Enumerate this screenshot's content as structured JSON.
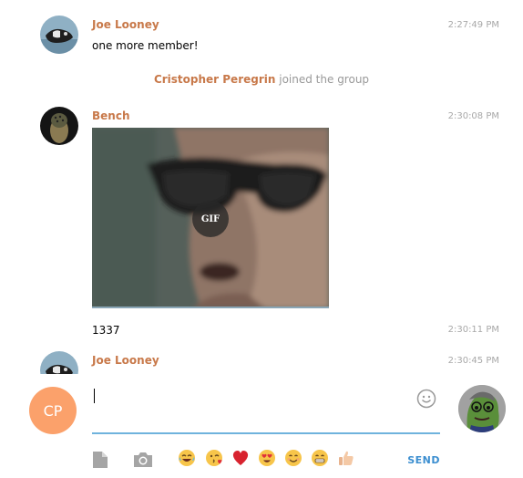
{
  "messages": [
    {
      "sender": "Joe Looney",
      "time": "2:27:49 PM",
      "text": "one more member!"
    },
    {
      "service_name": "Cristopher Peregrin",
      "service_text": "joined the group"
    },
    {
      "sender": "Bench",
      "time": "2:30:08 PM",
      "gif_label": "GIF"
    },
    {
      "time": "2:30:11 PM",
      "text": "1337"
    },
    {
      "sender": "Joe Looney",
      "time": "2:30:45 PM"
    }
  ],
  "compose": {
    "my_initials": "CP",
    "input_value": "",
    "send_label": "SEND",
    "quick_emojis": [
      "face-with-tears-of-joy",
      "face-blowing-kiss",
      "red-heart",
      "heart-eyes",
      "smiling-face",
      "grinning-face",
      "thumbs-up"
    ]
  },
  "colors": {
    "sender": "#c8794a",
    "accent": "#3b8ed0",
    "my_avatar": "#fba16b",
    "input_underline": "#6fb3dd"
  }
}
